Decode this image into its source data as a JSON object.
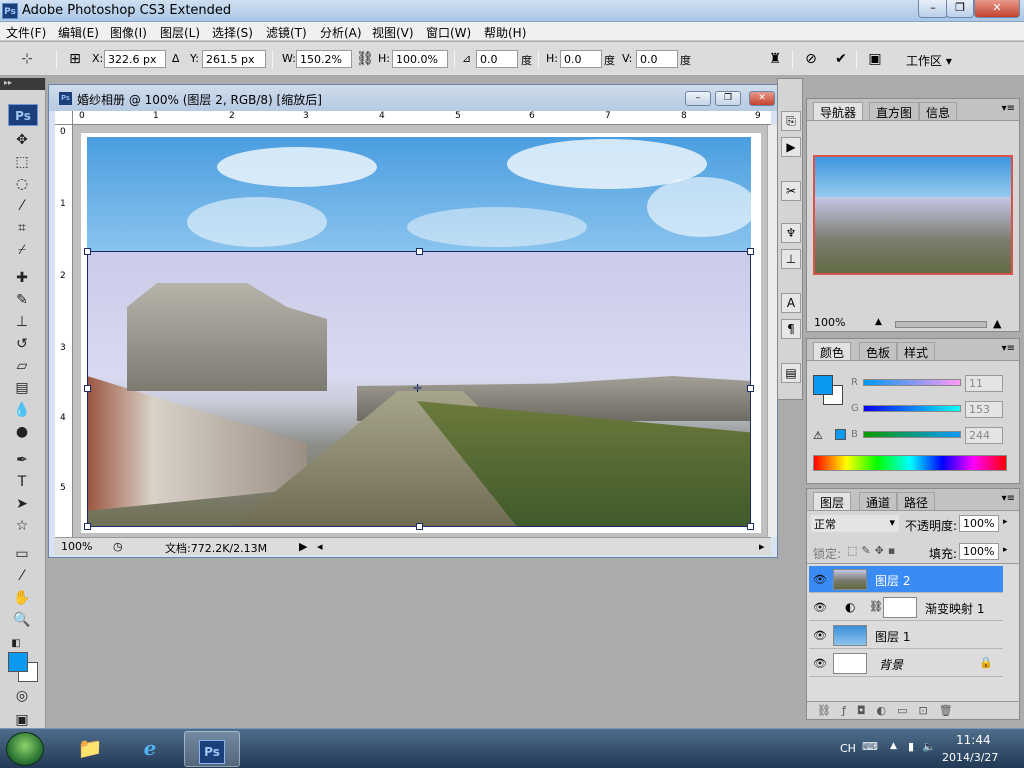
{
  "app": {
    "title": "Adobe Photoshop CS3 Extended",
    "ps_badge": "Ps"
  },
  "window_buttons": {
    "minimize": "–",
    "restore": "❐",
    "close": "✕"
  },
  "menu": [
    "文件(F)",
    "编辑(E)",
    "图像(I)",
    "图层(L)",
    "选择(S)",
    "滤镜(T)",
    "分析(A)",
    "视图(V)",
    "窗口(W)",
    "帮助(H)"
  ],
  "options": {
    "x_label": "X:",
    "x_value": "322.6 px",
    "y_label": "Y:",
    "y_value": "261.5 px",
    "w_label": "W:",
    "w_value": "150.2%",
    "h_label": "H:",
    "h_value": "100.0%",
    "angle_value": "0.0",
    "angle_unit": "度",
    "hskew_label": "H:",
    "hskew_value": "0.0",
    "hskew_unit": "度",
    "vskew_label": "V:",
    "vskew_value": "0.0",
    "vskew_unit": "度",
    "workspace": "工作区 ▾"
  },
  "document": {
    "title": "婚纱相册 @ 100% (图层 2, RGB/8) [缩放后]",
    "ruler_h": [
      "0",
      "1",
      "2",
      "3",
      "4",
      "5",
      "6",
      "7",
      "8",
      "9"
    ],
    "ruler_v": [
      "0",
      "1",
      "2",
      "3",
      "4",
      "5"
    ],
    "zoom": "100%",
    "doc_info": "文档:772.2K/2.13M"
  },
  "navigator": {
    "tabs": [
      "导航器",
      "直方图",
      "信息"
    ],
    "zoom": "100%"
  },
  "color": {
    "tabs": [
      "颜色",
      "色板",
      "样式"
    ],
    "r_label": "R",
    "r_value": "11",
    "g_label": "G",
    "g_value": "153",
    "b_label": "B",
    "b_value": "244",
    "foreground": "#0b99f4"
  },
  "layers": {
    "tabs": [
      "图层",
      "通道",
      "路径"
    ],
    "blend_mode": "正常",
    "opacity_label": "不透明度:",
    "opacity_value": "100%",
    "lock_label": "锁定:",
    "fill_label": "填充:",
    "fill_value": "100%",
    "items": [
      {
        "name": "图层 2",
        "active": true
      },
      {
        "name": "渐变映射 1",
        "active": false
      },
      {
        "name": "图层 1",
        "active": false
      },
      {
        "name": "背景",
        "active": false
      }
    ]
  },
  "taskbar": {
    "ps_label": "Ps",
    "lang": "CH",
    "time": "11:44",
    "date": "2014/3/27"
  }
}
